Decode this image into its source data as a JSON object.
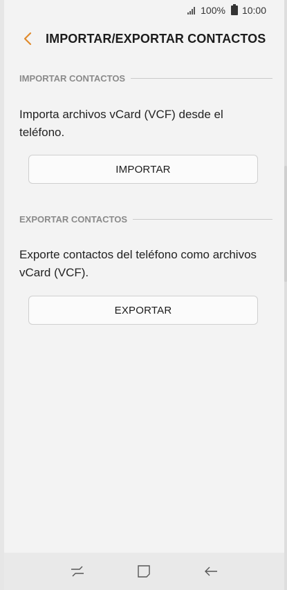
{
  "status_bar": {
    "battery": "100%",
    "time": "10:00"
  },
  "header": {
    "title": "IMPORTAR/EXPORTAR CONTACTOS",
    "back_icon": "chevron-left-icon",
    "accent_color": "#e08a2b"
  },
  "import_section": {
    "heading": "IMPORTAR CONTACTOS",
    "description": "Importa archivos vCard (VCF) desde el teléfono.",
    "button_label": "IMPORTAR"
  },
  "export_section": {
    "heading": "EXPORTAR CONTACTOS",
    "description": "Exporte contactos del teléfono como archivos vCard (VCF).",
    "button_label": "EXPORTAR"
  },
  "nav_bar": {
    "icons": [
      "recent-apps-icon",
      "home-icon",
      "back-arrow-icon"
    ]
  }
}
